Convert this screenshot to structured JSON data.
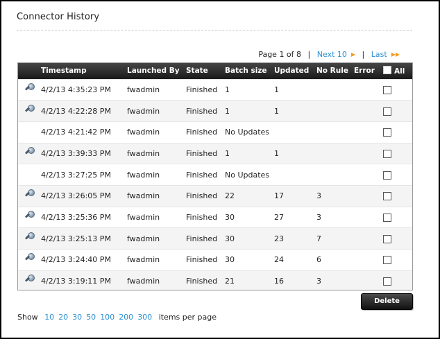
{
  "page": {
    "title": "Connector History"
  },
  "pager": {
    "page_text": "Page 1 of 8",
    "separator": "|",
    "next_label": "Next 10",
    "last_label": "Last",
    "next_icon": "arrow-right-icon",
    "last_icon": "double-arrow-right-icon",
    "accent_color": "#f39c1f",
    "link_color": "#2b8fd1"
  },
  "table": {
    "headers": {
      "timestamp": "Timestamp",
      "launched_by": "Launched By",
      "state": "State",
      "batch_size": "Batch size",
      "updated": "Updated",
      "no_rule": "No Rule",
      "error": "Error",
      "all": "All"
    },
    "rows": [
      {
        "has_details": true,
        "timestamp": "4/2/13 4:35:23 PM",
        "launched_by": "fwadmin",
        "state": "Finished",
        "batch_size": "1",
        "updated": "1",
        "no_rule": "",
        "error": ""
      },
      {
        "has_details": true,
        "timestamp": "4/2/13 4:22:28 PM",
        "launched_by": "fwadmin",
        "state": "Finished",
        "batch_size": "1",
        "updated": "1",
        "no_rule": "",
        "error": ""
      },
      {
        "has_details": false,
        "timestamp": "4/2/13 4:21:42 PM",
        "launched_by": "fwadmin",
        "state": "Finished",
        "batch_size": "No Updates",
        "updated": "",
        "no_rule": "",
        "error": ""
      },
      {
        "has_details": true,
        "timestamp": "4/2/13 3:39:33 PM",
        "launched_by": "fwadmin",
        "state": "Finished",
        "batch_size": "1",
        "updated": "1",
        "no_rule": "",
        "error": ""
      },
      {
        "has_details": false,
        "timestamp": "4/2/13 3:27:25 PM",
        "launched_by": "fwadmin",
        "state": "Finished",
        "batch_size": "No Updates",
        "updated": "",
        "no_rule": "",
        "error": ""
      },
      {
        "has_details": true,
        "timestamp": "4/2/13 3:26:05 PM",
        "launched_by": "fwadmin",
        "state": "Finished",
        "batch_size": "22",
        "updated": "17",
        "no_rule": "3",
        "error": ""
      },
      {
        "has_details": true,
        "timestamp": "4/2/13 3:25:36 PM",
        "launched_by": "fwadmin",
        "state": "Finished",
        "batch_size": "30",
        "updated": "27",
        "no_rule": "3",
        "error": ""
      },
      {
        "has_details": true,
        "timestamp": "4/2/13 3:25:13 PM",
        "launched_by": "fwadmin",
        "state": "Finished",
        "batch_size": "30",
        "updated": "23",
        "no_rule": "7",
        "error": ""
      },
      {
        "has_details": true,
        "timestamp": "4/2/13 3:24:40 PM",
        "launched_by": "fwadmin",
        "state": "Finished",
        "batch_size": "30",
        "updated": "24",
        "no_rule": "6",
        "error": ""
      },
      {
        "has_details": true,
        "timestamp": "4/2/13 3:19:11 PM",
        "launched_by": "fwadmin",
        "state": "Finished",
        "batch_size": "21",
        "updated": "16",
        "no_rule": "3",
        "error": ""
      }
    ],
    "details_icon": "magnifier-icon"
  },
  "actions": {
    "delete_label": "Delete"
  },
  "page_size": {
    "prefix": "Show",
    "options": [
      "10",
      "20",
      "30",
      "50",
      "100",
      "200",
      "300"
    ],
    "suffix": "items per page"
  }
}
